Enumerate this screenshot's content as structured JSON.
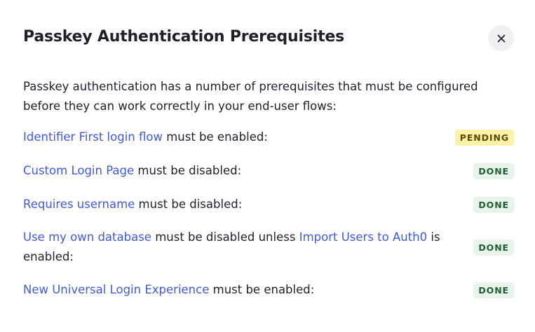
{
  "dialog": {
    "title": "Passkey Authentication Prerequisites",
    "close_icon": "close-icon",
    "intro": "Passkey authentication has a number of prerequisites that must be configured before they can work correctly in your end-user flows:"
  },
  "prerequisites": [
    {
      "link": "Identifier First login flow",
      "text": " must be enabled:",
      "status": "PENDING"
    },
    {
      "link": "Custom Login Page",
      "text": " must be disabled:",
      "status": "DONE"
    },
    {
      "link": "Requires username",
      "text": " must be disabled:",
      "status": "DONE"
    },
    {
      "link": "Use my own database",
      "text": " must be disabled unless ",
      "link2": "Import Users to Auth0",
      "text2": " is enabled:",
      "status": "DONE"
    },
    {
      "link": "New Universal Login Experience",
      "text": " must be enabled:",
      "status": "DONE"
    }
  ],
  "colors": {
    "link": "#3f59e4",
    "pending_bg": "#fbf1a8",
    "done_bg": "#e6f4ea"
  }
}
